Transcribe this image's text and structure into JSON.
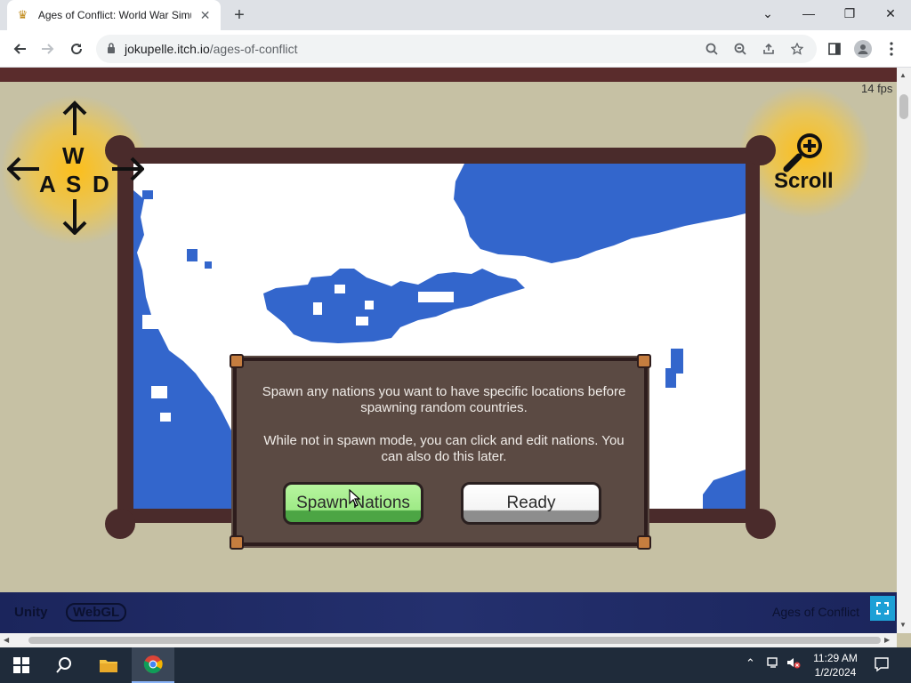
{
  "browser": {
    "tab_title": "Ages of Conflict: World War Simu",
    "tab_close": "✕",
    "new_tab": "+",
    "url_host": "jokupelle.itch.io",
    "url_path": "/ages-of-conflict",
    "window_controls": {
      "tab_search": "⌄",
      "minimize": "—",
      "restore": "❐",
      "close": "✕"
    }
  },
  "game": {
    "fps": "14 fps",
    "controls_hint": {
      "w": "W",
      "a": "A",
      "s": "S",
      "d": "D",
      "scroll": "Scroll"
    },
    "dialog": {
      "line1": "Spawn any nations you want to have specific locations before spawning random countries.",
      "line2": "While not in spawn mode, you can click and edit nations. You can also do this later.",
      "spawn_button": "Spawn Nations",
      "ready_button": "Ready"
    },
    "footer": {
      "unity": "Unity",
      "webgl": "WebGL",
      "title": "Ages of Conflict"
    }
  },
  "taskbar": {
    "time": "11:29 AM",
    "date": "1/2/2024"
  },
  "colors": {
    "frame": "#4a2b2b",
    "map_water": "#3366cc",
    "dialog_bg": "#5b4a43",
    "spawn_button": "#9eea86",
    "glow": "#ffbe14"
  }
}
